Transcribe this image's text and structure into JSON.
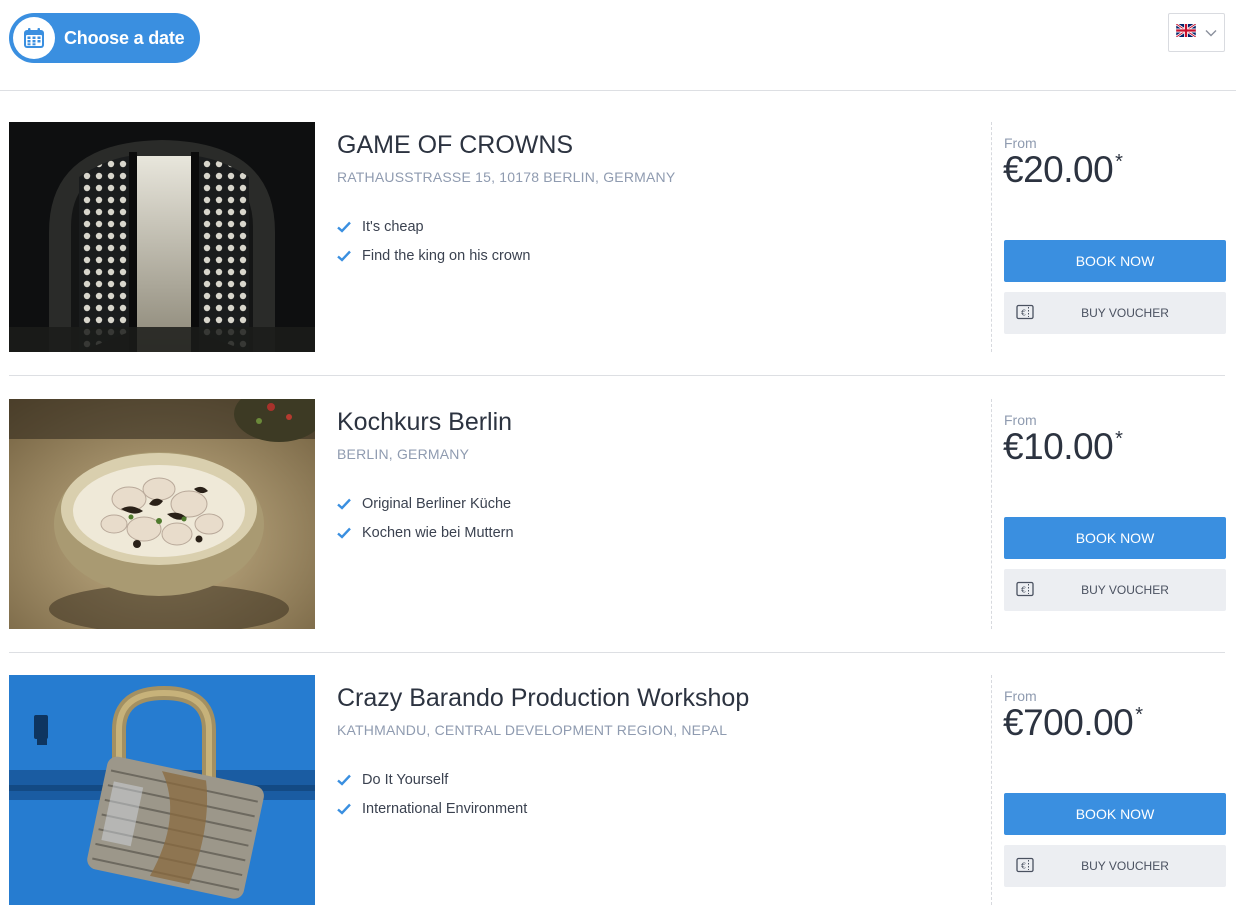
{
  "header": {
    "date_button_label": "Choose a date",
    "calendar_icon": "calendar-icon",
    "language_icon": "uk-flag-icon",
    "dropdown_icon": "chevron-down-icon"
  },
  "colors": {
    "accent": "#3a8fe0",
    "secondary_button": "#eceef2",
    "muted_text": "#8f9bb0"
  },
  "listings": [
    {
      "title": "GAME OF CROWNS",
      "address": "RATHAUSSTRASSE 15, 10178 BERLIN, GERMANY",
      "features": [
        "It's cheap",
        "Find the king on his crown"
      ],
      "from_label": "From",
      "price": "€20.00",
      "price_mark": "*",
      "book_label": "BOOK NOW",
      "voucher_label": "BUY VOUCHER",
      "image_icon": "dark-gate-photo"
    },
    {
      "title": "Kochkurs Berlin",
      "address": "BERLIN, GERMANY",
      "features": [
        "Original Berliner Küche",
        "Kochen wie bei Muttern"
      ],
      "from_label": "From",
      "price": "€10.00",
      "price_mark": "*",
      "book_label": "BOOK NOW",
      "voucher_label": "BUY VOUCHER",
      "image_icon": "food-bowl-photo"
    },
    {
      "title": "Crazy Barando Production Workshop",
      "address": "KATHMANDU, CENTRAL DEVELOPMENT REGION, NEPAL",
      "features": [
        "Do It Yourself",
        "International Environment"
      ],
      "from_label": "From",
      "price": "€700.00",
      "price_mark": "*",
      "book_label": "BOOK NOW",
      "voucher_label": "BUY VOUCHER",
      "image_icon": "padlock-photo"
    }
  ]
}
